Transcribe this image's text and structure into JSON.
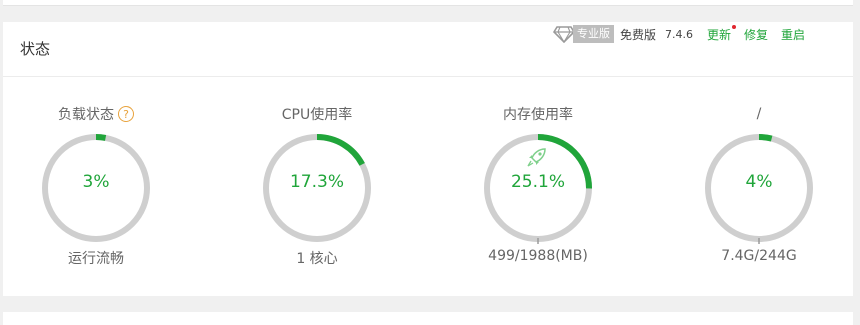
{
  "header": {
    "title": "状态",
    "pro_label": "专业版",
    "free_label": "免费版",
    "version": "7.4.6",
    "update_label": "更新",
    "repair_label": "修复",
    "restart_label": "重启"
  },
  "gauges": [
    {
      "title": "负载状态",
      "value_text": "3%",
      "value": 0.03,
      "sub": "运行流畅",
      "has_help": true
    },
    {
      "title": "CPU使用率",
      "value_text": "17.3%",
      "value": 0.173,
      "sub": "1 核心"
    },
    {
      "title": "内存使用率",
      "value_text": "25.1%",
      "value": 0.251,
      "sub": "499/1988(MB)",
      "has_rocket": true
    },
    {
      "title": "/",
      "value_text": "4%",
      "value": 0.04,
      "sub": "7.4G/244G"
    }
  ],
  "colors": {
    "accent": "#20a53a",
    "track": "#cfcfcf",
    "help": "#e8a33d",
    "dot": "#e0262f"
  }
}
